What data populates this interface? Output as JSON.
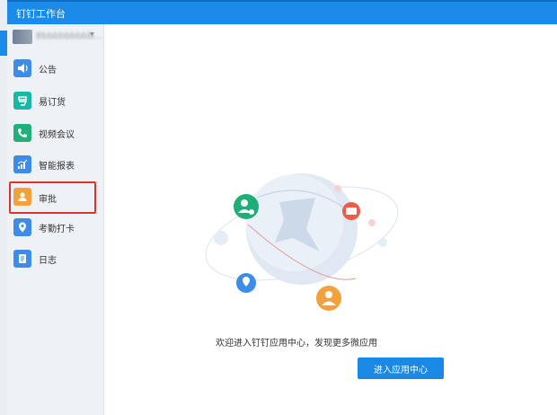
{
  "window": {
    "title": "钉钉工作台"
  },
  "user": {
    "name": "Bbbbbbbbbb...",
    "caret": "▾"
  },
  "sidebar": {
    "items": [
      {
        "label": "公告",
        "icon": "megaphone-icon",
        "color": "#3d8ce8"
      },
      {
        "label": "易订货",
        "icon": "yidinghuo-icon",
        "color": "#19b7a4"
      },
      {
        "label": "视频会议",
        "icon": "phone-icon",
        "color": "#21b07a"
      },
      {
        "label": "智能报表",
        "icon": "chart-icon",
        "color": "#3d8ce8"
      },
      {
        "label": "审批",
        "icon": "person-icon",
        "color": "#f2a13c"
      },
      {
        "label": "考勤打卡",
        "icon": "location-icon",
        "color": "#3d8ce8"
      },
      {
        "label": "日志",
        "icon": "notebook-icon",
        "color": "#3d8ce8"
      }
    ]
  },
  "main": {
    "empty_text": "欢迎进入钉钉应用中心，发现更多微应用",
    "button_label": "进入应用中心"
  },
  "colors": {
    "accent": "#1b8ae8",
    "highlight": "#e0322b"
  }
}
